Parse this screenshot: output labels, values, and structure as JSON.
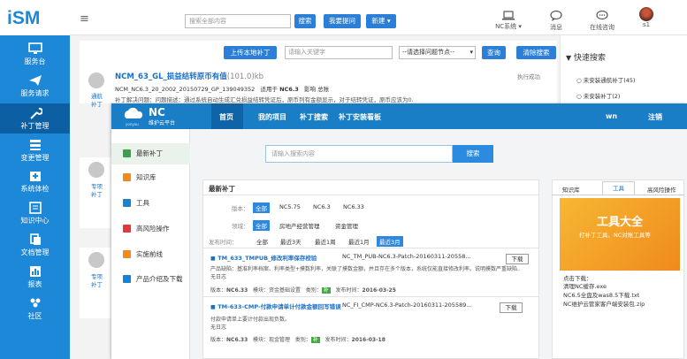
{
  "app": {
    "logo": "iSM"
  },
  "sidebar": {
    "items": [
      {
        "label": "服务台",
        "icon": "monitor-icon"
      },
      {
        "label": "服务请求",
        "icon": "send-icon"
      },
      {
        "label": "补丁管理",
        "icon": "wrench-icon"
      },
      {
        "label": "变更管理",
        "icon": "list-icon"
      },
      {
        "label": "系统体检",
        "icon": "hospital-icon"
      },
      {
        "label": "知识中心",
        "icon": "book-icon"
      },
      {
        "label": "文档管理",
        "icon": "document-icon"
      },
      {
        "label": "报表",
        "icon": "chart-icon"
      },
      {
        "label": "社区",
        "icon": "community-icon"
      }
    ]
  },
  "header": {
    "search_placeholder": "搜索全部内容",
    "search_button": "搜索",
    "ask_button": "我要提问",
    "new_button": "新建",
    "nc_system": "NC系统",
    "message": "消息",
    "online_consult": "在线咨询",
    "user": "s1"
  },
  "toolbar": {
    "upload_button": "上传本地补丁",
    "keyword_placeholder": "请输入关键字",
    "node_select": "--请选择问题节点--",
    "query_button": "查询",
    "clear_button": "清除搜索"
  },
  "patch_list": {
    "items": [
      {
        "title": "NCM_63_GL_损益结转原币有值",
        "size": "(101.0)kb",
        "code": "NCM_NC6.3_20_2002_20150729_GP_139049352",
        "fit_label": "适用于",
        "fit_version": "NC6.3",
        "impact_label": "影响",
        "impact": "总账",
        "status": "执行成功",
        "desc": "补丁解决问题：问题描述：通过系统自动生成汇兑损益结转凭证后，原币列有金额显示，对于结转凭证，原币应该为0.",
        "side_label1": "通航",
        "side_label2": "补丁"
      },
      {
        "side_label1": "专项",
        "side_label2": "补丁"
      },
      {
        "side_label1": "专项",
        "side_label2": "补丁"
      }
    ]
  },
  "quick_search": {
    "title": "快速搜索",
    "items": [
      "未安装通航补丁(45)",
      "未安装补丁(2)"
    ]
  },
  "nc_platform": {
    "logo": "NC",
    "logo_sub": "维护云平台",
    "logo_small": "yonyou",
    "nav": [
      "首页",
      "我的项目",
      "补丁搜索",
      "补丁安装看板"
    ],
    "user": "wn",
    "logout": "注销",
    "left_menu": [
      {
        "label": "最新补丁",
        "color": "#3aa04a"
      },
      {
        "label": "知识库",
        "color": "#f08a1c"
      },
      {
        "label": "工具",
        "color": "#1a80d0"
      },
      {
        "label": "高风险操作",
        "color": "#e03a3a"
      },
      {
        "label": "实施前线",
        "color": "#f08a1c"
      },
      {
        "label": "产品介绍及下载",
        "color": "#1a80d0"
      }
    ],
    "search_placeholder": "请输入搜索内容",
    "search_button": "搜索",
    "section_title": "最新补丁",
    "version_label": "版本：",
    "versions": [
      "全部",
      "NC5.75",
      "NC6.3",
      "NC6.33"
    ],
    "domain_label": "领域：",
    "domains": [
      "全部",
      "房地产经营管理",
      "资金管理"
    ],
    "time_label": "发布时间：",
    "times": [
      "全部",
      "最近3天",
      "最近1周",
      "最近1月",
      "最近3月"
    ],
    "patches": [
      {
        "title": "TM_633_TMPUB_修改利率保存校验",
        "code": "NC_TM_PUB-NC6.3-Patch-20160311-20558...",
        "desc": "产品缺陷：基准利率档案、利率类型+摸数利率，关联了摸数金额，并且存在多个版本，系统仅能直接修改利率。说明摸数严重缺陷...",
        "desc2": "无日志",
        "download": "下载",
        "version_label": "版本：",
        "version": "NC6.33",
        "module_label": "模块：",
        "module": "资金基础设置",
        "type_label": "类别：",
        "type": "补",
        "date_label": "发布时间：",
        "date": "2016-03-25"
      },
      {
        "title": "TM-633-CMP-付款申请单计付款金额回写错误",
        "code": "NC_FI_CMP-NC6.3-Patch-20160311-205589...",
        "desc": "付款申请单上要计付款出现负数。",
        "desc2": "无日志",
        "download": "下载",
        "version_label": "版本：",
        "version": "NC6.33",
        "module_label": "模块：",
        "module": "现金管理",
        "type_label": "类别：",
        "type": "补",
        "date_label": "发布时间：",
        "date": "2016-03-18"
      }
    ],
    "right_tabs": [
      "知识库",
      "工具",
      "高风险操作"
    ],
    "banner_title": "工具大全",
    "banner_sub": "打补丁工具、NC对账工具等",
    "download_label": "点击下载：",
    "downloads": [
      "清理NC缓存.exe",
      "NC6.5全盘及was8.5下载.txt",
      "NC维护云管家客户端安装包.zip"
    ]
  },
  "colors": {
    "accent": "#1e88d8",
    "nc_blue": "#1a7ec6",
    "banner_orange": "#f5a623"
  }
}
